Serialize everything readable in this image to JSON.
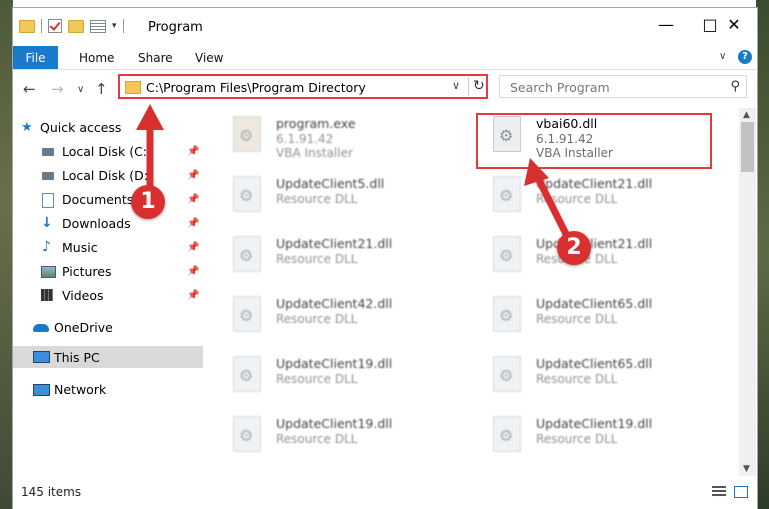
{
  "window": {
    "title": "Program",
    "controls": [
      "minimize-icon",
      "maximize-icon",
      "close-icon"
    ]
  },
  "ribbon": {
    "tabs": [
      {
        "label": "File"
      },
      {
        "label": "Home"
      },
      {
        "label": "Share"
      },
      {
        "label": "View"
      }
    ],
    "help": "?"
  },
  "address": {
    "path": "C:\\Program Files\\Program Directory"
  },
  "search": {
    "placeholder": "Search Program"
  },
  "sidebar": {
    "items": [
      {
        "label": "Quick access",
        "icon": "star-icon"
      },
      {
        "label": "Local Disk (C:)",
        "icon": "drive-icon",
        "pinned": true
      },
      {
        "label": "Local Disk (D:)",
        "icon": "drive-icon",
        "pinned": true
      },
      {
        "label": "Documents",
        "icon": "documents-icon",
        "pinned": true
      },
      {
        "label": "Downloads",
        "icon": "downloads-icon",
        "pinned": true
      },
      {
        "label": "Music",
        "icon": "music-icon",
        "pinned": true
      },
      {
        "label": "Pictures",
        "icon": "pictures-icon",
        "pinned": true
      },
      {
        "label": "Videos",
        "icon": "videos-icon",
        "pinned": true
      },
      {
        "label": "OneDrive",
        "icon": "onedrive-icon"
      },
      {
        "label": "This PC",
        "icon": "pc-icon",
        "selected": true
      },
      {
        "label": "Network",
        "icon": "network-icon"
      }
    ]
  },
  "files": {
    "left": [
      {
        "name": "program.exe",
        "sub": "6.1.91.42",
        "sub2": "VBA Installer"
      },
      {
        "name": "UpdateClient5.dll",
        "sub": "Resource DLL"
      },
      {
        "name": "UpdateClient21.dll",
        "sub": "Resource DLL"
      },
      {
        "name": "UpdateClient42.dll",
        "sub": "Resource DLL"
      },
      {
        "name": "UpdateClient19.dll",
        "sub": "Resource DLL"
      },
      {
        "name": "UpdateClient19.dll",
        "sub": "Resource DLL"
      }
    ],
    "right": [
      {
        "name": "vbai60.dll",
        "sub": "6.1.91.42",
        "sub2": "VBA Installer"
      },
      {
        "name": "UpdateClient21.dll",
        "sub": "Resource DLL"
      },
      {
        "name": "UpdateClient21.dll",
        "sub": "Resource DLL"
      },
      {
        "name": "UpdateClient65.dll",
        "sub": "Resource DLL"
      },
      {
        "name": "UpdateClient65.dll",
        "sub": "Resource DLL"
      },
      {
        "name": "UpdateClient19.dll",
        "sub": "Resource DLL"
      }
    ]
  },
  "status": {
    "count": "145 items"
  },
  "annotations": {
    "badge1": "1",
    "badge2": "2",
    "color": "#d92f2f"
  }
}
